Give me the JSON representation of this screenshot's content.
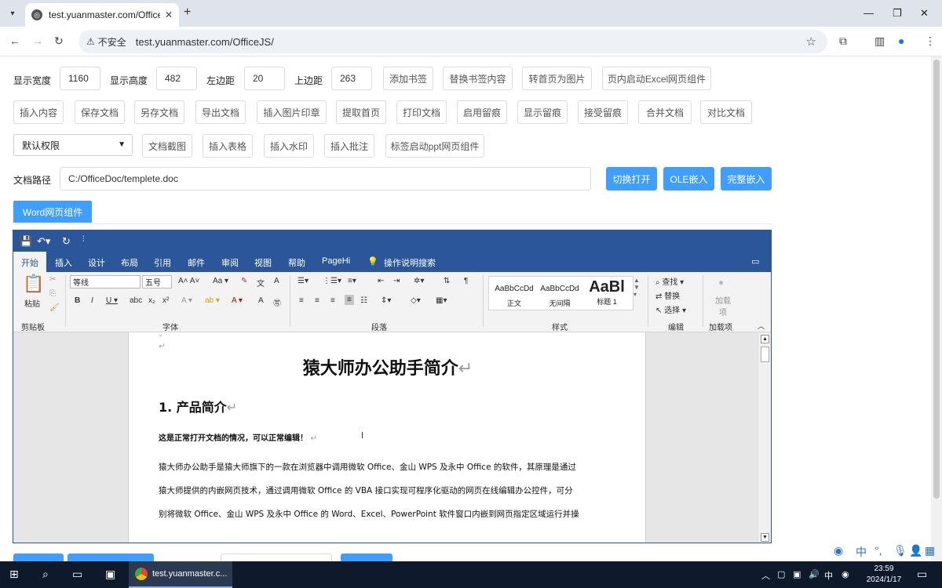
{
  "browser": {
    "tab_title": "test.yuanmaster.com/OfficeJS/",
    "new_tab": "+",
    "insecure_label": "不安全",
    "url": "test.yuanmaster.com/OfficeJS/"
  },
  "form": {
    "width_label": "显示宽度",
    "width_value": "1160",
    "height_label": "显示高度",
    "height_value": "482",
    "left_label": "左边距",
    "left_value": "20",
    "top_label": "上边距",
    "top_value": "263",
    "row1_buttons": [
      "添加书签",
      "替换书签内容",
      "转首页为图片",
      "页内启动Excel网页组件"
    ],
    "row2_buttons": [
      "插入内容",
      "保存文档",
      "另存文档",
      "导出文档",
      "插入图片印章",
      "提取首页",
      "打印文档",
      "启用留痕",
      "显示留痕",
      "接受留痕",
      "合并文档",
      "对比文档"
    ],
    "permission_select": "默认权限",
    "row3_buttons": [
      "文档截图",
      "插入表格",
      "插入水印",
      "插入批注",
      "标签启动ppt网页组件"
    ],
    "path_label": "文档路径",
    "path_value": "C:/OfficeDoc/templete.doc",
    "open_switch": "切换打开",
    "ole_embed": "OLE嵌入",
    "full_embed": "完整嵌入",
    "component_tab": "Word网页组件"
  },
  "word": {
    "menu": [
      "开始",
      "插入",
      "设计",
      "布局",
      "引用",
      "邮件",
      "审阅",
      "视图",
      "帮助",
      "PageHi",
      "操作说明搜索"
    ],
    "paste": "粘贴",
    "clipboard_label": "剪贴板",
    "font_label": "字体",
    "paragraph_label": "段落",
    "styles_label": "样式",
    "edit_label": "编辑",
    "addins_label": "加载项",
    "font_name": "等线",
    "font_size": "五号",
    "style_items": [
      {
        "sample": "AaBbCcDd",
        "name": "正文"
      },
      {
        "sample": "AaBbCcDd",
        "name": "无间隔"
      },
      {
        "sample": "AaBl",
        "name": "标题 1"
      }
    ],
    "find": "查找",
    "replace": "替换",
    "select": "选择",
    "addins": "加载项",
    "doc": {
      "title": "猿大师办公助手简介",
      "heading": "1. 产品简介",
      "bold_line": "这是正常打开文档的情况，可以正常编辑！",
      "para_lines": [
        "猿大师办公助手是猿大师旗下的一款在浏览器中调用微软 Office、金山 WPS 及永中 Office 的软件，其原理是通过",
        "猿大师提供的内嵌网页技术，通过调用微软 Office 的 VBA 接口实现可程序化驱动的网页在线编辑办公控件，可分",
        "别将微软 Office、金山 WPS 及永中 Office 的 Word、Excel、PowerPoint 软件窗口内嵌到网页指定区域运行并操"
      ]
    }
  },
  "taskbar": {
    "app_title": "test.yuanmaster.c...",
    "ime": "中",
    "time": "23:59",
    "date": "2024/1/17"
  },
  "colors": {
    "primary": "#409eff",
    "word_blue": "#2b579a",
    "taskbar": "#0e1a2b"
  }
}
